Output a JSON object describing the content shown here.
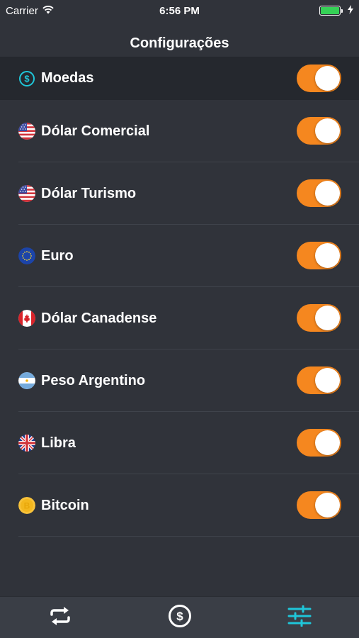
{
  "status_bar": {
    "carrier": "Carrier",
    "time": "6:56 PM"
  },
  "nav": {
    "title": "Configurações"
  },
  "section": {
    "label": "Moedas",
    "icon": "dollar-circle-icon",
    "enabled": true
  },
  "currencies": [
    {
      "label": "Dólar Comercial",
      "icon": "us-flag-icon",
      "enabled": true
    },
    {
      "label": "Dólar Turismo",
      "icon": "us-flag-icon",
      "enabled": true
    },
    {
      "label": "Euro",
      "icon": "eu-flag-icon",
      "enabled": true
    },
    {
      "label": "Dólar Canadense",
      "icon": "canada-flag-icon",
      "enabled": true
    },
    {
      "label": "Peso Argentino",
      "icon": "argentina-flag-icon",
      "enabled": true
    },
    {
      "label": "Libra",
      "icon": "uk-flag-icon",
      "enabled": true
    },
    {
      "label": "Bitcoin",
      "icon": "bitcoin-icon",
      "enabled": true
    }
  ],
  "tab_bar": {
    "items": [
      {
        "icon": "exchange-arrows-icon",
        "active": false
      },
      {
        "icon": "dollar-coin-icon",
        "active": false
      },
      {
        "icon": "settings-sliders-icon",
        "active": true
      }
    ]
  },
  "colors": {
    "background": "#30333a",
    "header_background": "#25282e",
    "accent_orange": "#f5871f",
    "accent_cyan": "#1fc6d9",
    "battery_green": "#35d156"
  }
}
